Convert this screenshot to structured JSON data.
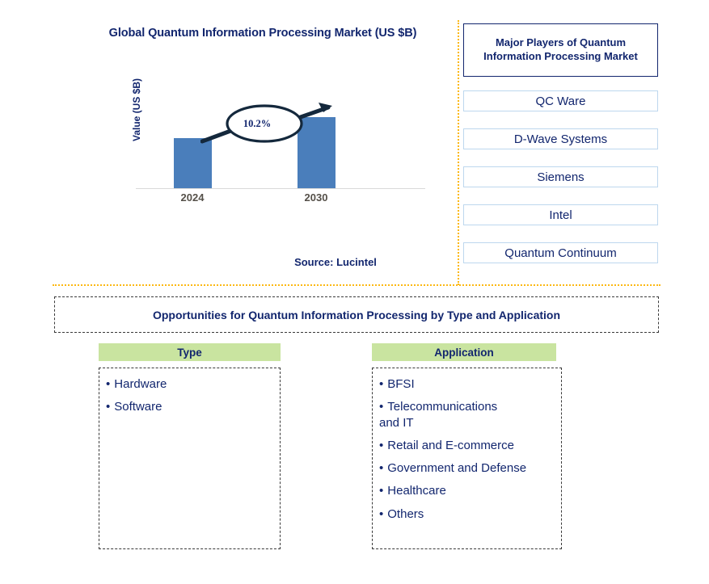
{
  "chart_panel": {
    "title": "Global Quantum Information Processing Market (US $B)",
    "source": "Source: Lucintel"
  },
  "chart_data": {
    "type": "bar",
    "title": "Global Quantum Information Processing Market (US $B)",
    "categories": [
      "2024",
      "2030"
    ],
    "values": [
      62,
      88
    ],
    "xlabel": "",
    "ylabel": "Value (US $B)",
    "annotation": "10.2%",
    "annotation_kind": "cagr-callout",
    "grid": false,
    "legend": "none",
    "bar_color": "#4a7ebb",
    "tick_label_color": "#555049"
  },
  "players": {
    "header": "Major Players of Quantum Information Processing Market",
    "items": [
      {
        "label": "QC Ware"
      },
      {
        "label": "D-Wave Systems"
      },
      {
        "label": "Siemens"
      },
      {
        "label": "Intel"
      },
      {
        "label": "Quantum Continuum"
      }
    ]
  },
  "opportunities": {
    "banner": "Opportunities for Quantum Information Processing by Type and Application",
    "columns": [
      {
        "header": "Type",
        "items": [
          "Hardware",
          "Software"
        ]
      },
      {
        "header": "Application",
        "items": [
          "BFSI",
          "Telecommunications\nand IT",
          "Retail and E-commerce",
          "Government and Defense",
          "Healthcare",
          "Others"
        ]
      }
    ]
  },
  "colors": {
    "navy": "#12266e",
    "bar_blue": "#4a7ebb",
    "divider_orange": "#fcb813",
    "header_green": "#c9e4a0",
    "player_border": "#bdd7ee"
  }
}
